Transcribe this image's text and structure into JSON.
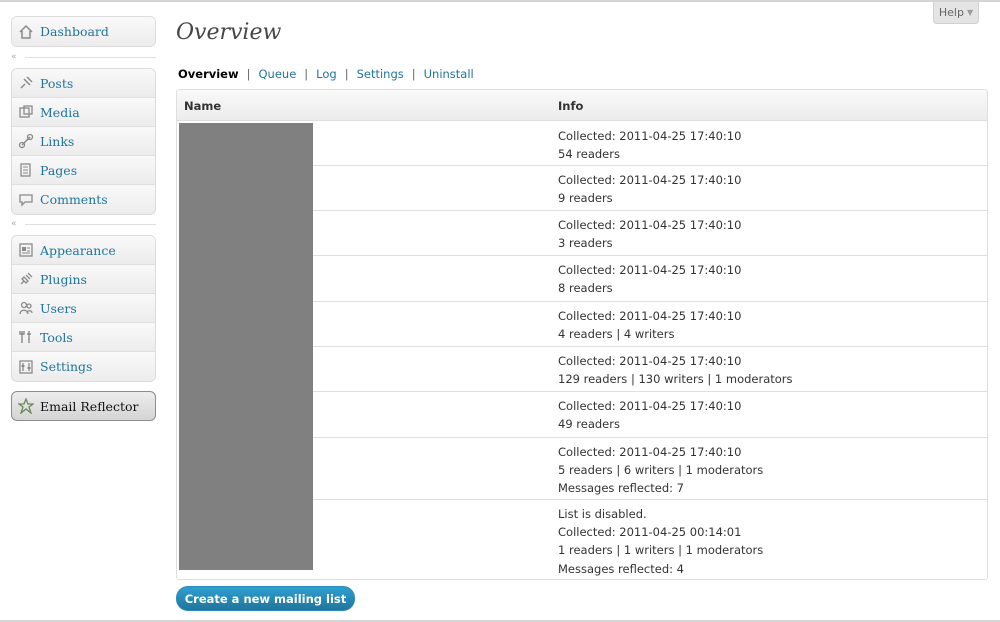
{
  "sidebar": {
    "group1": [
      {
        "label": "Dashboard",
        "icon": "dashboard-icon"
      }
    ],
    "group2": [
      {
        "label": "Posts",
        "icon": "pin-icon"
      },
      {
        "label": "Media",
        "icon": "media-icon"
      },
      {
        "label": "Links",
        "icon": "link-icon"
      },
      {
        "label": "Pages",
        "icon": "pages-icon"
      },
      {
        "label": "Comments",
        "icon": "comment-icon"
      }
    ],
    "group3": [
      {
        "label": "Appearance",
        "icon": "appearance-icon"
      },
      {
        "label": "Plugins",
        "icon": "plugin-icon"
      },
      {
        "label": "Users",
        "icon": "users-icon"
      },
      {
        "label": "Tools",
        "icon": "tools-icon"
      },
      {
        "label": "Settings",
        "icon": "settings-icon"
      }
    ],
    "plugin_item": {
      "label": "Email Reflector",
      "icon": "email-reflector-icon"
    }
  },
  "header": {
    "title": "Overview",
    "help_label": "Help"
  },
  "subnav": [
    {
      "label": "Overview",
      "current": true
    },
    {
      "label": "Queue",
      "current": false
    },
    {
      "label": "Log",
      "current": false
    },
    {
      "label": "Settings",
      "current": false
    },
    {
      "label": "Uninstall",
      "current": false
    }
  ],
  "table": {
    "columns": [
      "Name",
      "Info"
    ],
    "rows": [
      {
        "lines": [
          "Collected: 2011-04-25 17:40:10",
          "54 readers"
        ]
      },
      {
        "lines": [
          "Collected: 2011-04-25 17:40:10",
          "9 readers"
        ]
      },
      {
        "lines": [
          "Collected: 2011-04-25 17:40:10",
          "3 readers"
        ]
      },
      {
        "lines": [
          "Collected: 2011-04-25 17:40:10",
          "8 readers"
        ]
      },
      {
        "lines": [
          "Collected: 2011-04-25 17:40:10",
          "4 readers | 4 writers"
        ]
      },
      {
        "lines": [
          "Collected: 2011-04-25 17:40:10",
          "129 readers | 130 writers | 1 moderators"
        ]
      },
      {
        "lines": [
          "Collected: 2011-04-25 17:40:10",
          "49 readers"
        ]
      },
      {
        "lines": [
          "Collected: 2011-04-25 17:40:10",
          "5 readers | 6 writers | 1 moderators",
          "Messages reflected: 7"
        ]
      },
      {
        "lines": [
          "List is disabled.",
          "Collected: 2011-04-25 00:14:01",
          "1 readers | 1 writers | 1 moderators",
          "Messages reflected: 4"
        ]
      }
    ]
  },
  "create_button_label": "Create a new mailing list",
  "colors": {
    "link": "#21759b",
    "button": "#21759b",
    "redacted_block": "#808080"
  }
}
